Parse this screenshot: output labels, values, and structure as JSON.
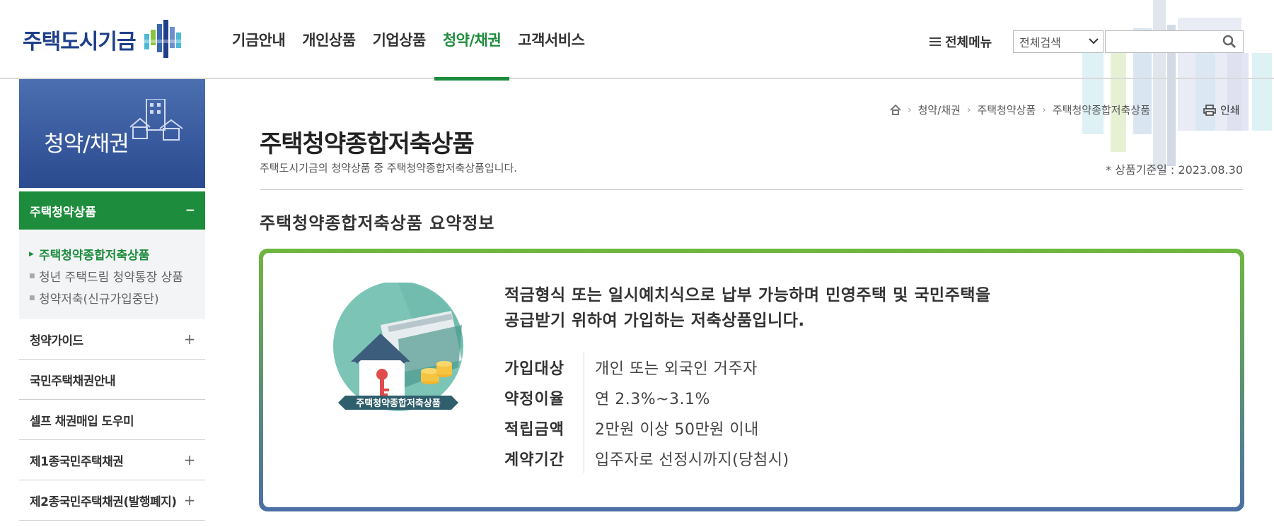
{
  "header": {
    "logo_text": "주택도시기금",
    "nav": [
      "기금안내",
      "개인상품",
      "기업상품",
      "청약/채권",
      "고객서비스"
    ],
    "active_nav_index": 3,
    "all_menu_label": "전체메뉴",
    "search_select_value": "전체검색",
    "search_input_value": "",
    "icons": {
      "menu": "hamburger-icon",
      "search": "magnifier-icon",
      "select": "chevron-down-icon"
    }
  },
  "sidebar": {
    "title": "청약/채권",
    "open_menu": {
      "label": "주택청약상품",
      "toggle": "−"
    },
    "sub_items": [
      {
        "label": "주택청약종합저축상품",
        "active": true
      },
      {
        "label": "청년 주택드림 청약통장 상품",
        "active": false
      },
      {
        "label": "청약저축(신규가입중단)",
        "active": false
      }
    ],
    "items": [
      {
        "label": "청약가이드",
        "toggle": "+"
      },
      {
        "label": "국민주택채권안내",
        "toggle": ""
      },
      {
        "label": "셀프 채권매입 도우미",
        "toggle": ""
      },
      {
        "label": "제1종국민주택채권",
        "toggle": "+"
      },
      {
        "label": "제2종국민주택채권(발행폐지)",
        "toggle": "+"
      }
    ]
  },
  "main": {
    "breadcrumb": [
      "청약/채권",
      "주택청약상품",
      "주택청약종합저축상품"
    ],
    "print_label": "인쇄",
    "page_title": "주택청약종합저축상품",
    "page_desc": "주택도시기금의 청약상품 중 주택청약종합저축상품입니다.",
    "base_date": "* 상품기준일 : 2023.08.30",
    "section_title": "주택청약종합저축상품 요약정보",
    "card": {
      "badge_label": "주택청약종합저축상품",
      "headline_line1": "적금형식 또는 일시예치식으로 납부 가능하며 민영주택 및 국민주택을",
      "headline_line2": "공급받기 위하여 가입하는 저축상품입니다.",
      "info": [
        {
          "label": "가입대상",
          "value": "개인 또는 외국인 거주자"
        },
        {
          "label": "약정이율",
          "value": "연 2.3%~3.1%"
        },
        {
          "label": "적립금액",
          "value": "2만원 이상 50만원 이내"
        },
        {
          "label": "계약기간",
          "value": "입주자로 선정시까지(당첨시)"
        }
      ]
    }
  },
  "colors": {
    "brand_green": "#1d8c3c",
    "brand_navy": "#2b4a8f",
    "card_top": "#6fb63f",
    "card_bottom": "#4a6fa5"
  }
}
